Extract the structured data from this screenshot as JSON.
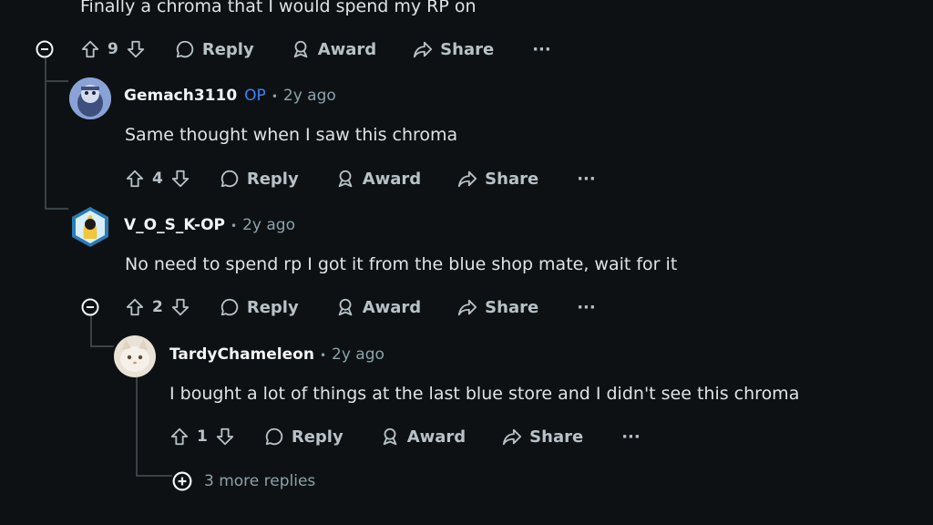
{
  "parent": {
    "text": "Finally a chroma that I would spend my RP on",
    "votes": "9"
  },
  "comments": [
    {
      "user": "Gemach3110",
      "op": "OP",
      "dot": "•",
      "time": "2y ago",
      "text": "Same thought when I saw this chroma",
      "votes": "4"
    },
    {
      "user": "V_O_S_K-OP",
      "dot": "•",
      "time": "2y ago",
      "text": "No need to spend rp I got it from the blue shop mate, wait for it",
      "votes": "2"
    },
    {
      "user": "TardyChameleon",
      "dot": "•",
      "time": "2y ago",
      "text": "I bought a lot of things at the last blue store and I didn't see this chroma",
      "votes": "1"
    }
  ],
  "actions": {
    "reply": "Reply",
    "award": "Award",
    "share": "Share",
    "more": "···"
  },
  "more_replies": "3 more replies",
  "colors": {
    "background": "#0e1113",
    "op_badge": "#3b82f6",
    "muted": "#8ba2ad"
  }
}
